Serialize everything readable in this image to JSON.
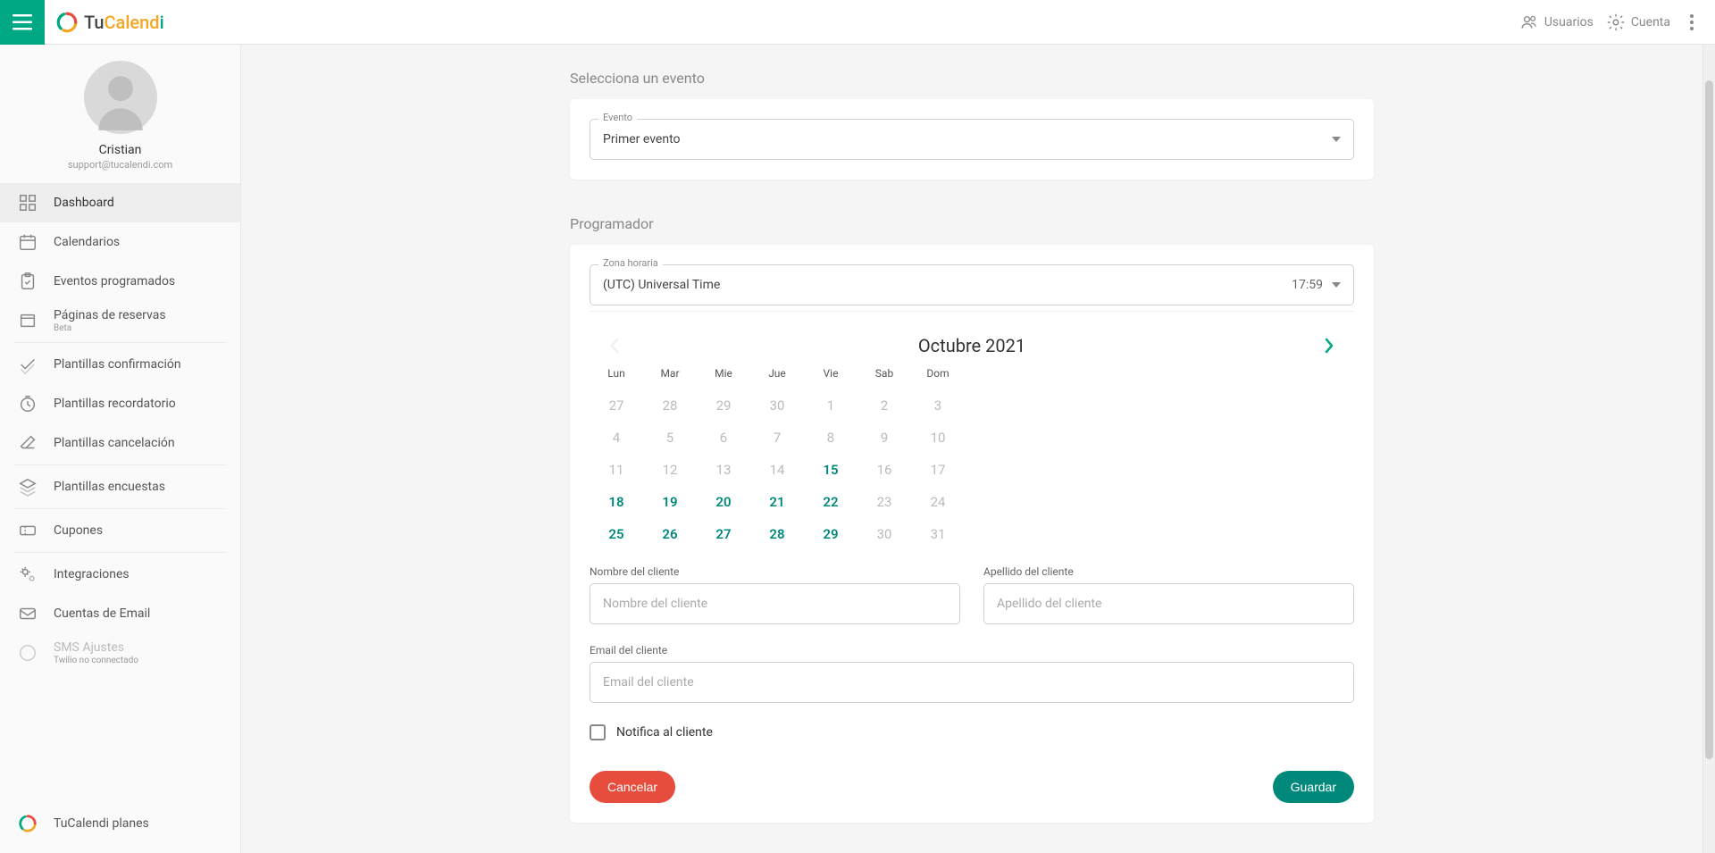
{
  "brand": {
    "tu": "Tu",
    "cal": "Calend",
    "i": "i"
  },
  "top": {
    "users": "Usuarios",
    "account": "Cuenta"
  },
  "profile": {
    "name": "Cristian",
    "email": "support@tucalendi.com"
  },
  "nav": {
    "dashboard": "Dashboard",
    "calendars": "Calendarios",
    "scheduled": "Eventos programados",
    "booking": "Páginas de reservas",
    "booking_sub": "Beta",
    "tpl_confirm": "Plantillas confirmación",
    "tpl_reminder": "Plantillas recordatorio",
    "tpl_cancel": "Plantillas cancelación",
    "tpl_survey": "Plantillas encuestas",
    "coupons": "Cupones",
    "integrations": "Integraciones",
    "email_acc": "Cuentas de Email",
    "sms": "SMS Ajustes",
    "sms_sub": "Twilio no connectado",
    "plans": "TuCalendi planes"
  },
  "section": {
    "select_event": "Selecciona un evento",
    "scheduler": "Programador"
  },
  "event": {
    "label": "Evento",
    "value": "Primer evento"
  },
  "tz": {
    "label": "Zona horaria",
    "value": "(UTC) Universal Time",
    "time": "17:59"
  },
  "calendar": {
    "title": "Octubre 2021",
    "dow": [
      "Lun",
      "Mar",
      "Mie",
      "Jue",
      "Vie",
      "Sab",
      "Dom"
    ],
    "weeks": [
      [
        {
          "d": "27"
        },
        {
          "d": "28"
        },
        {
          "d": "29"
        },
        {
          "d": "30"
        },
        {
          "d": "1"
        },
        {
          "d": "2"
        },
        {
          "d": "3"
        }
      ],
      [
        {
          "d": "4"
        },
        {
          "d": "5"
        },
        {
          "d": "6"
        },
        {
          "d": "7"
        },
        {
          "d": "8"
        },
        {
          "d": "9"
        },
        {
          "d": "10"
        }
      ],
      [
        {
          "d": "11"
        },
        {
          "d": "12"
        },
        {
          "d": "13"
        },
        {
          "d": "14"
        },
        {
          "d": "15",
          "a": true
        },
        {
          "d": "16"
        },
        {
          "d": "17"
        }
      ],
      [
        {
          "d": "18",
          "a": true
        },
        {
          "d": "19",
          "a": true
        },
        {
          "d": "20",
          "a": true
        },
        {
          "d": "21",
          "a": true
        },
        {
          "d": "22",
          "a": true
        },
        {
          "d": "23"
        },
        {
          "d": "24"
        }
      ],
      [
        {
          "d": "25",
          "a": true
        },
        {
          "d": "26",
          "a": true
        },
        {
          "d": "27",
          "a": true
        },
        {
          "d": "28",
          "a": true
        },
        {
          "d": "29",
          "a": true
        },
        {
          "d": "30"
        },
        {
          "d": "31"
        }
      ]
    ]
  },
  "form": {
    "first_label": "Nombre del cliente",
    "first_ph": "Nombre del cliente",
    "last_label": "Apellido del cliente",
    "last_ph": "Apellido del cliente",
    "email_label": "Email del cliente",
    "email_ph": "Email del cliente",
    "notify": "Notifica al cliente"
  },
  "buttons": {
    "cancel": "Cancelar",
    "save": "Guardar"
  }
}
